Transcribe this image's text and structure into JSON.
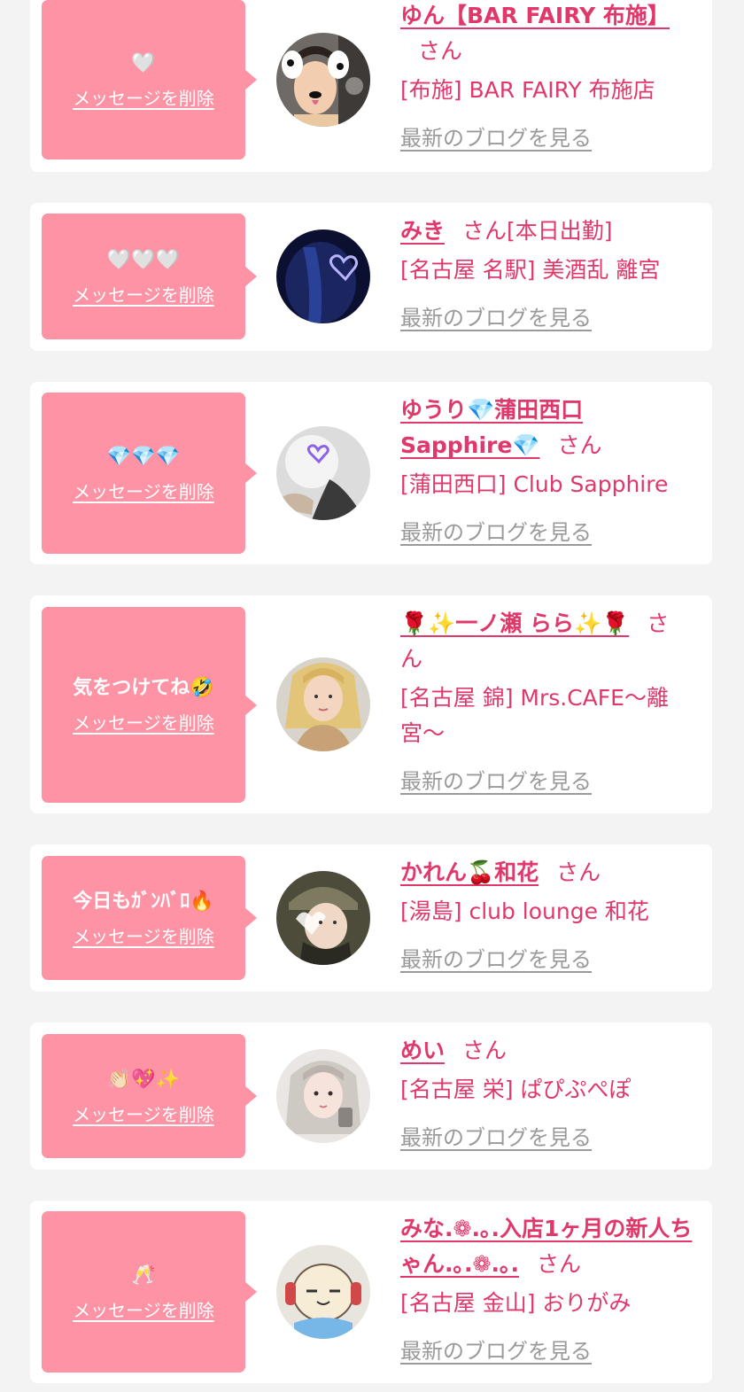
{
  "labels": {
    "delete_message": "メッセージを削除",
    "view_blog": "最新のブログを見る",
    "honorific": "さん"
  },
  "colors": {
    "page_background": "#f3f3f3",
    "card_background": "#ffffff",
    "bubble_background": "#fd93a4",
    "accent_text": "#e0386a",
    "link_gray": "#9a9a9a"
  },
  "cards": [
    {
      "message": "🤍",
      "name": "ゆん【BAR FAIRY 布施】",
      "extra": "",
      "shop": "[布施] BAR FAIRY 布施店",
      "avatar_icon": "dog-filter-photo"
    },
    {
      "message": "🤍🤍🤍",
      "name": "みき",
      "extra": "[本日出勤]",
      "shop": "[名古屋 名駅] 美酒乱 離宮",
      "avatar_icon": "neon-heart-photo"
    },
    {
      "message": "💎💎💎",
      "name": "ゆうり💎蒲田西口Sapphire💎",
      "extra": "",
      "shop": "[蒲田西口] Club Sapphire",
      "avatar_icon": "heart-sticker-photo"
    },
    {
      "message": "気をつけてね🤣",
      "name": "🌹✨一ノ瀬 らら✨🌹",
      "extra": "",
      "shop": "[名古屋 錦] Mrs.CAFE〜離宮〜",
      "avatar_icon": "blonde-portrait-photo"
    },
    {
      "message": "今日もｶﾞﾝﾊﾞﾛ🔥",
      "name": "かれん🍒和花",
      "extra": "",
      "shop": "[湯島] club lounge 和花",
      "avatar_icon": "cap-selfie-photo"
    },
    {
      "message": "👏🏻💖✨",
      "name": "めい",
      "extra": "",
      "shop": "[名古屋 栄] ぱぴぷぺぽ",
      "avatar_icon": "ash-hair-portrait-photo"
    },
    {
      "message": "🥂",
      "name": "みな.❁.｡.入店1ヶ月の新人ちゃん.｡.❁.｡.",
      "extra": "",
      "shop": "[名古屋 金山] おりがみ",
      "avatar_icon": "cartoon-character-photo"
    }
  ]
}
